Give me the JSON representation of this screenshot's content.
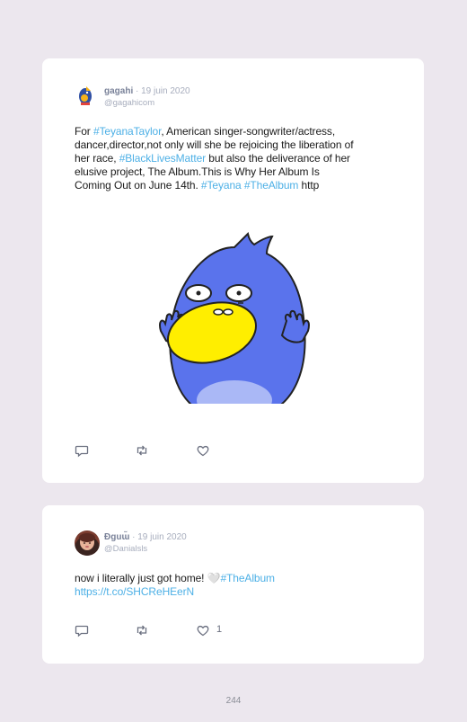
{
  "tweets": [
    {
      "username": "gagahi",
      "date": "· 19 juin 2020",
      "handle": "@gagahicom",
      "lines": [
        [
          {
            "t": "For "
          },
          {
            "t": "#TeyanaTaylor",
            "tag": true
          },
          {
            "t": ", American singer-songwriter/actress,"
          }
        ],
        [
          {
            "t": "dancer,director,not only will she be rejoicing the liberation of"
          }
        ],
        [
          {
            "t": "her race, "
          },
          {
            "t": "#BlackLivesMatter",
            "tag": true
          },
          {
            "t": " but also the deliverance of her"
          }
        ],
        [
          {
            "t": "elusive project, The Album.This is Why Her Album Is"
          }
        ],
        [
          {
            "t": "Coming Out on June 14th. "
          },
          {
            "t": "#Teyana",
            "tag": true
          },
          {
            "t": " "
          },
          {
            "t": "#TheAlbum",
            "tag": true
          },
          {
            "t": " http"
          }
        ]
      ],
      "actions": {
        "reply_icon": "reply-icon",
        "retweet_icon": "retweet-icon",
        "like_icon": "heart-icon"
      }
    },
    {
      "username": "Ðɡuɯ̃",
      "date": "· 19 juin 2020",
      "handle": "@Danialsls",
      "lines": [
        [
          {
            "t": "now i literally just got home! "
          },
          {
            "t": "🤍",
            "emoji": true
          },
          {
            "t": "#TheAlbum",
            "tag": true
          }
        ],
        [
          {
            "t": "https://t.co/SHCReHEerN",
            "tag": true
          }
        ]
      ],
      "like_count": "1",
      "actions": {
        "reply_icon": "reply-icon",
        "retweet_icon": "retweet-icon",
        "like_icon": "heart-icon"
      }
    }
  ],
  "page_number": "244",
  "colors": {
    "background": "#ece7ee",
    "card": "#ffffff",
    "hashtag": "#4db0e6",
    "icon": "#6b7080"
  }
}
